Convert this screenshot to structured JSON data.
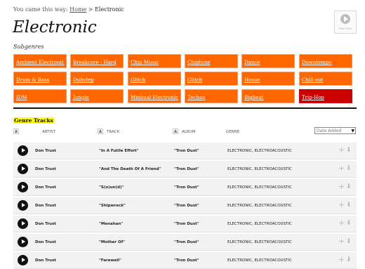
{
  "breadcrumb": {
    "prefix": "You came this way:",
    "home": "Home",
    "sep": ">",
    "current": "Electronic"
  },
  "page_title": "Electronic",
  "play_all": {
    "label": "PLAY PAGE"
  },
  "subgenres_heading": "Subgenres",
  "genres": [
    [
      "Ambient Electronic",
      "Breakcore - Hard",
      "Chip Music",
      "Chiptune",
      "Dance",
      "Downtempo"
    ],
    [
      "Drum & Bass",
      "Dubstep",
      "Glitch",
      "Glitch",
      "House",
      "Chill-out"
    ],
    [
      "IDM",
      "Jungle",
      "Minimal Electronic",
      "Techno",
      "Bigbeat",
      "Trip-Hop"
    ]
  ],
  "active_genre": "Trip-Hop",
  "section_title": "Genre Tracks",
  "table": {
    "headers": {
      "artist": "ARTIST",
      "track": "TRACK",
      "album": "ALBUM",
      "genre": "GENRE"
    },
    "sort_option": "Date Added"
  },
  "tracks": [
    {
      "artist": "Don Trust",
      "track": "\"In A Futile Effort\"",
      "album": "\"Tron Dust\"",
      "genre": "ELECTRONIC, ELECTROACOUSTIC"
    },
    {
      "artist": "Don Trust",
      "track": "\"And The Death Of A Friend\"",
      "album": "\"Tron Dust\"",
      "genre": "ELECTRONIC, ELECTROACOUSTIC"
    },
    {
      "artist": "Don Trust",
      "track": "\"S(o)un(d)\"",
      "album": "\"Tron Dust\"",
      "genre": "ELECTRONIC, ELECTROACOUSTIC"
    },
    {
      "artist": "Don Trust",
      "track": "\"Shipwreck\"",
      "album": "\"Tron Dust\"",
      "genre": "ELECTRONIC, ELECTROACOUSTIC"
    },
    {
      "artist": "Don Trust",
      "track": "\"Menahan\"",
      "album": "\"Tron Dust\"",
      "genre": "ELECTRONIC, ELECTROACOUSTIC"
    },
    {
      "artist": "Don Trust",
      "track": "\"Mother Of\"",
      "album": "\"Tron Dust\"",
      "genre": "ELECTRONIC, ELECTROACOUSTIC"
    },
    {
      "artist": "Don Trust",
      "track": "\"Farewell\"",
      "album": "\"Tron Dust\"",
      "genre": "ELECTRONIC, ELECTROACOUSTIC"
    }
  ],
  "colors": {
    "genre_bg": "#ff6600",
    "genre_active": "#cc0000",
    "section_highlight": "#ffff00"
  },
  "icons": {
    "row_play": "play-icon",
    "row_add": "plus-icon",
    "row_download": "down-arrow-icon"
  }
}
